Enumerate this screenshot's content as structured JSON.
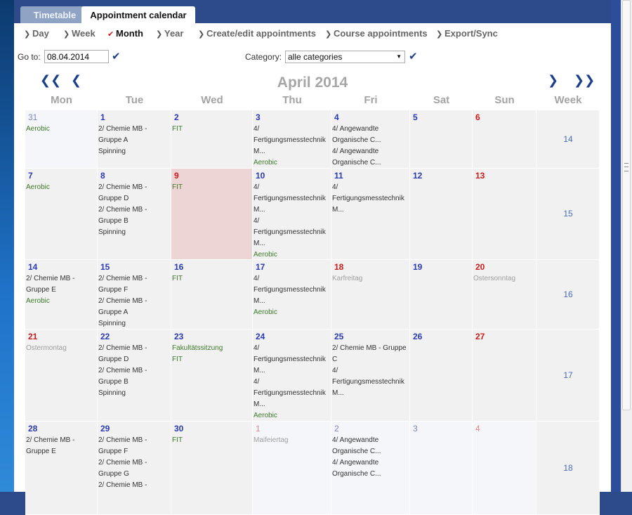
{
  "tabs": [
    {
      "label": "Timetable",
      "active": false
    },
    {
      "label": "Appointment calendar",
      "active": true
    }
  ],
  "nav": [
    {
      "label": "Day",
      "active": false
    },
    {
      "label": "Week",
      "active": false
    },
    {
      "label": "Month",
      "active": true
    },
    {
      "label": "Year",
      "active": false
    },
    {
      "label": "Create/edit appointments",
      "active": false
    },
    {
      "label": "Course appointments",
      "active": false
    },
    {
      "label": "Export/Sync",
      "active": false
    }
  ],
  "goto": {
    "label": "Go to:",
    "value": "08.04.2014"
  },
  "category": {
    "label": "Category:",
    "value": "alle categories"
  },
  "calendar": {
    "title": "April 2014",
    "day_headers": [
      "Mon",
      "Tue",
      "Wed",
      "Thu",
      "Fri",
      "Sat",
      "Sun",
      "Week"
    ],
    "weeks": [
      {
        "week": "14",
        "days": [
          {
            "num": "31",
            "other": true,
            "events": [
              {
                "t": "Aerobic",
                "c": "green"
              }
            ]
          },
          {
            "num": "1",
            "events": [
              {
                "t": "2/ Chemie MB -"
              },
              {
                "t": "Gruppe A"
              },
              {
                "t": "Spinning"
              }
            ]
          },
          {
            "num": "2",
            "events": [
              {
                "t": "FIT",
                "c": "green"
              }
            ]
          },
          {
            "num": "3",
            "events": [
              {
                "t": "4/"
              },
              {
                "t": "Fertigungsmesstechnik"
              },
              {
                "t": "M..."
              },
              {
                "t": "Aerobic",
                "c": "green"
              }
            ]
          },
          {
            "num": "4",
            "events": [
              {
                "t": "4/ Angewandte"
              },
              {
                "t": "Organische C..."
              },
              {
                "t": "4/ Angewandte"
              },
              {
                "t": "Organische C..."
              }
            ]
          },
          {
            "num": "5",
            "events": []
          },
          {
            "num": "6",
            "sun": true,
            "events": []
          }
        ]
      },
      {
        "week": "15",
        "days": [
          {
            "num": "7",
            "events": [
              {
                "t": "Aerobic",
                "c": "green"
              }
            ]
          },
          {
            "num": "8",
            "events": [
              {
                "t": "2/ Chemie MB -"
              },
              {
                "t": "Gruppe D"
              },
              {
                "t": "2/ Chemie MB -"
              },
              {
                "t": "Gruppe B"
              },
              {
                "t": "Spinning"
              }
            ]
          },
          {
            "num": "9",
            "today": true,
            "sun": true,
            "events": [
              {
                "t": "FIT",
                "c": "green"
              }
            ]
          },
          {
            "num": "10",
            "events": [
              {
                "t": "4/"
              },
              {
                "t": "Fertigungsmesstechnik"
              },
              {
                "t": "M..."
              },
              {
                "t": "4/"
              },
              {
                "t": "Fertigungsmesstechnik"
              },
              {
                "t": "M..."
              },
              {
                "t": "Aerobic",
                "c": "green"
              }
            ]
          },
          {
            "num": "11",
            "events": [
              {
                "t": "4/"
              },
              {
                "t": "Fertigungsmesstechnik"
              },
              {
                "t": "M..."
              }
            ]
          },
          {
            "num": "12",
            "events": []
          },
          {
            "num": "13",
            "sun": true,
            "events": []
          }
        ]
      },
      {
        "week": "16",
        "days": [
          {
            "num": "14",
            "events": [
              {
                "t": "2/ Chemie MB -"
              },
              {
                "t": "Gruppe E"
              },
              {
                "t": "Aerobic",
                "c": "green"
              }
            ]
          },
          {
            "num": "15",
            "events": [
              {
                "t": "2/ Chemie MB -"
              },
              {
                "t": "Gruppe F"
              },
              {
                "t": "2/ Chemie MB -"
              },
              {
                "t": "Gruppe A"
              },
              {
                "t": "Spinning"
              }
            ]
          },
          {
            "num": "16",
            "events": [
              {
                "t": "FIT",
                "c": "green"
              }
            ]
          },
          {
            "num": "17",
            "events": [
              {
                "t": "4/"
              },
              {
                "t": "Fertigungsmesstechnik"
              },
              {
                "t": "M..."
              },
              {
                "t": "Aerobic",
                "c": "green"
              }
            ]
          },
          {
            "num": "18",
            "hol": true,
            "events": [
              {
                "t": "Karfreitag",
                "c": "grey"
              }
            ]
          },
          {
            "num": "19",
            "events": []
          },
          {
            "num": "20",
            "sun": true,
            "events": [
              {
                "t": "Ostersonntag",
                "c": "grey"
              }
            ]
          }
        ]
      },
      {
        "week": "17",
        "days": [
          {
            "num": "21",
            "hol": true,
            "events": [
              {
                "t": "Ostermontag",
                "c": "grey"
              }
            ]
          },
          {
            "num": "22",
            "events": [
              {
                "t": "2/ Chemie MB -"
              },
              {
                "t": "Gruppe D"
              },
              {
                "t": "2/ Chemie MB -"
              },
              {
                "t": "Gruppe B"
              },
              {
                "t": "Spinning"
              }
            ]
          },
          {
            "num": "23",
            "events": [
              {
                "t": "Fakultätssitzung",
                "c": "green"
              },
              {
                "t": "FIT",
                "c": "green"
              }
            ]
          },
          {
            "num": "24",
            "events": [
              {
                "t": "4/"
              },
              {
                "t": "Fertigungsmesstechnik"
              },
              {
                "t": "M..."
              },
              {
                "t": "4/"
              },
              {
                "t": "Fertigungsmesstechnik"
              },
              {
                "t": "M..."
              },
              {
                "t": "Aerobic",
                "c": "green"
              }
            ]
          },
          {
            "num": "25",
            "events": [
              {
                "t": "2/ Chemie MB - Gruppe"
              },
              {
                "t": "C"
              },
              {
                "t": "4/"
              },
              {
                "t": "Fertigungsmesstechnik"
              },
              {
                "t": "M..."
              }
            ]
          },
          {
            "num": "26",
            "events": []
          },
          {
            "num": "27",
            "sun": true,
            "events": []
          }
        ]
      },
      {
        "week": "18",
        "days": [
          {
            "num": "28",
            "events": [
              {
                "t": "2/ Chemie MB -"
              },
              {
                "t": "Gruppe E"
              }
            ]
          },
          {
            "num": "29",
            "events": [
              {
                "t": "2/ Chemie MB -"
              },
              {
                "t": "Gruppe F"
              },
              {
                "t": "2/ Chemie MB -"
              },
              {
                "t": "Gruppe G"
              },
              {
                "t": "2/ Chemie MB -"
              }
            ]
          },
          {
            "num": "30",
            "events": [
              {
                "t": "FIT",
                "c": "green"
              }
            ]
          },
          {
            "num": "1",
            "other": true,
            "hol": true,
            "events": [
              {
                "t": "Maifeiertag",
                "c": "grey"
              }
            ]
          },
          {
            "num": "2",
            "other": true,
            "events": [
              {
                "t": "4/ Angewandte"
              },
              {
                "t": "Organische C..."
              },
              {
                "t": "4/ Angewandte"
              },
              {
                "t": "Organische C..."
              }
            ]
          },
          {
            "num": "3",
            "other": true,
            "events": []
          },
          {
            "num": "4",
            "other": true,
            "sun": true,
            "events": []
          }
        ]
      }
    ]
  }
}
